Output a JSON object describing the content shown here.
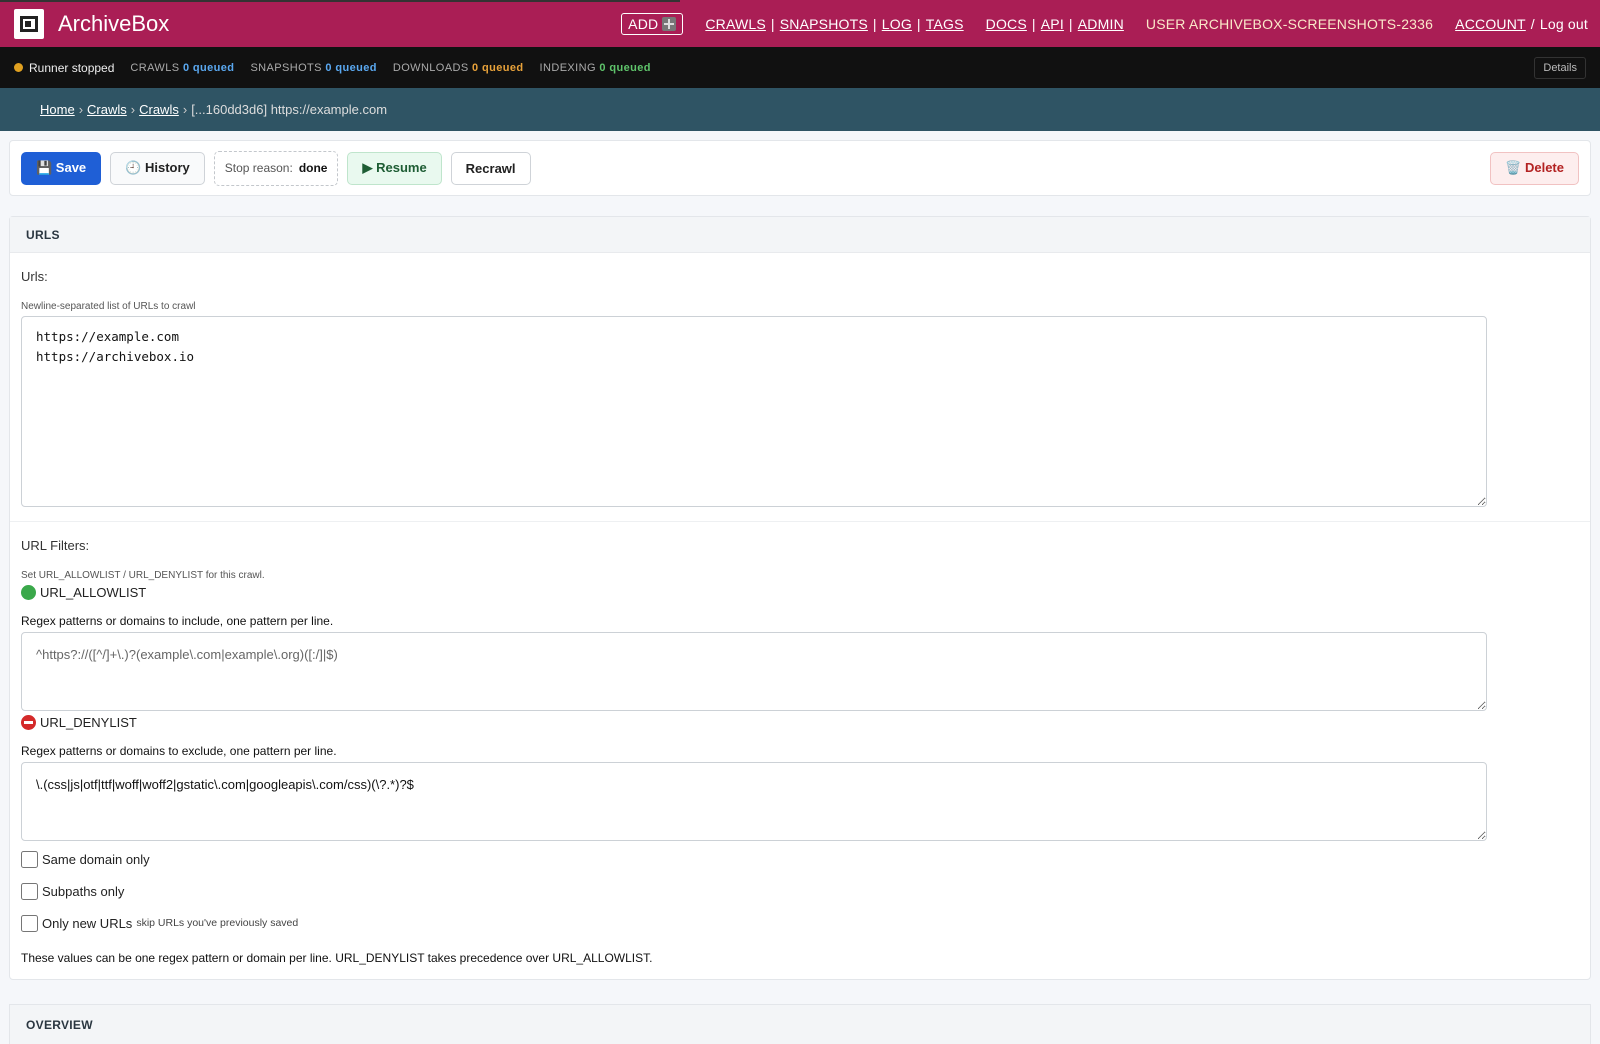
{
  "header": {
    "brand": "ArchiveBox",
    "add_label": "ADD",
    "nav_links": [
      "CRAWLS",
      "SNAPSHOTS",
      "LOG",
      "TAGS"
    ],
    "doc_links": [
      "DOCS",
      "API",
      "ADMIN"
    ],
    "user": "USER ARCHIVEBOX-SCREENSHOTS-2336",
    "account": "ACCOUNT",
    "logout": "Log out",
    "color": "#aa1e55"
  },
  "statusbar": {
    "runner": "Runner stopped",
    "crawls_label": "CRAWLS",
    "crawls_value": "0 queued",
    "snapshots_label": "SNAPSHOTS",
    "snapshots_value": "0 queued",
    "downloads_label": "DOWNLOADS",
    "downloads_value": "0 queued",
    "indexing_label": "INDEXING",
    "indexing_value": "0 queued",
    "details": "Details"
  },
  "breadcrumb": {
    "items": [
      "Home",
      "Crawls",
      "Crawls"
    ],
    "current": "[...160dd3d6] https://example.com"
  },
  "toolbar": {
    "save": "💾 Save",
    "history": "🕘 History",
    "stop_reason_label": "Stop reason:",
    "stop_reason_value": "done",
    "resume": "▶ Resume",
    "recrawl": "Recrawl",
    "delete": "🗑️ Delete"
  },
  "urls_section": {
    "title": "URLS",
    "urls_label": "Urls:",
    "urls_help": "Newline-separated list of URLs to crawl",
    "urls_value": "https://example.com\nhttps://archivebox.io",
    "filters_label": "URL Filters:",
    "filters_help": "Set URL_ALLOWLIST / URL_DENYLIST for this crawl.",
    "allowlist_title": "URL_ALLOWLIST",
    "allowlist_desc": "Regex patterns or domains to include, one pattern per line.",
    "allowlist_placeholder": "^https?://([^/]+\\.)?(example\\.com|example\\.org)([:/]|$)",
    "denylist_title": "URL_DENYLIST",
    "denylist_desc": "Regex patterns or domains to exclude, one pattern per line.",
    "denylist_value": "\\.(css|js|otf|ttf|woff|woff2|gstatic\\.com|googleapis\\.com/css)(\\?.*)?$",
    "same_domain": "Same domain only",
    "subpaths": "Subpaths only",
    "only_new": "Only new URLs",
    "only_new_hint": "skip URLs you've previously saved",
    "note": "These values can be one regex pattern or domain per line. URL_DENYLIST takes precedence over URL_ALLOWLIST."
  },
  "overview_section": {
    "title": "OVERVIEW"
  }
}
